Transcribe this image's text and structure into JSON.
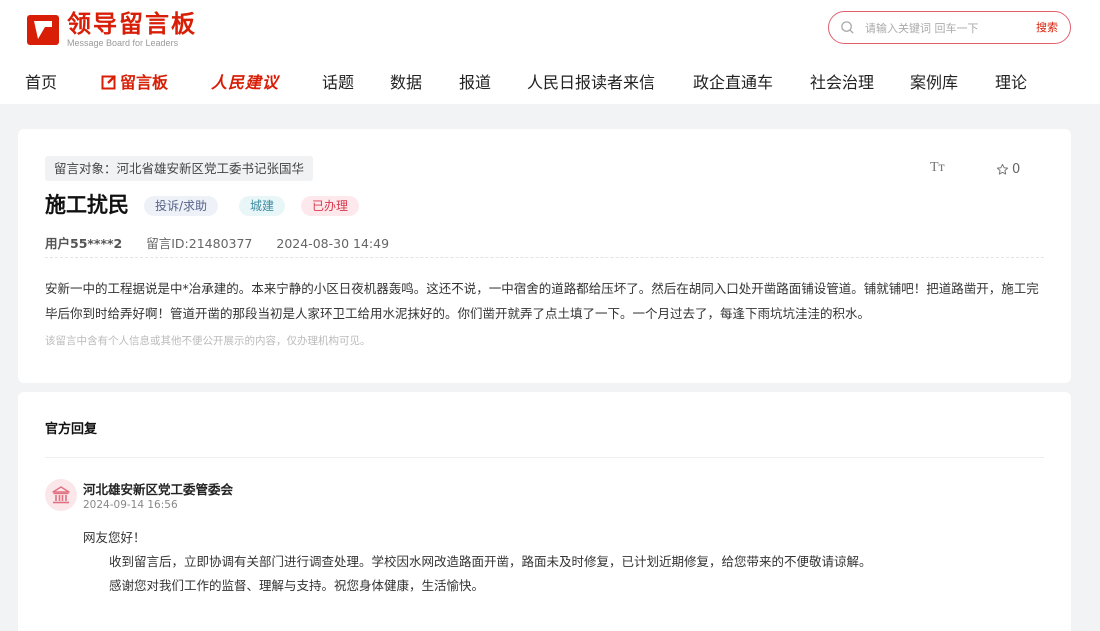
{
  "header": {
    "logo_title": "领导留言板",
    "logo_subtitle": "Message Board for Leaders",
    "search_placeholder": "请输入关键词 回车一下",
    "search_button": "搜索"
  },
  "nav": {
    "items": [
      {
        "label": "首页"
      },
      {
        "label": "留言板"
      },
      {
        "label": "人民建议"
      },
      {
        "label": "话题"
      },
      {
        "label": "数据"
      },
      {
        "label": "报道"
      },
      {
        "label": "人民日报读者来信"
      },
      {
        "label": "政企直通车"
      },
      {
        "label": "社会治理"
      },
      {
        "label": "案例库"
      },
      {
        "label": "理论"
      }
    ]
  },
  "message": {
    "target": "留言对象：河北省雄安新区党工委书记张国华",
    "font_toggle": "Tт",
    "fav_count": "0",
    "title": "施工扰民",
    "tags": {
      "type": "投诉/求助",
      "field": "城建",
      "status": "已办理"
    },
    "user": "用户55****2",
    "id": "留言ID:21480377",
    "datetime": "2024-08-30 14:49",
    "content": "安新一中的工程据说是中*冶承建的。本来宁静的小区日夜机器轰鸣。这还不说，一中宿舍的道路都给压坏了。然后在胡同入口处开凿路面铺设管道。铺就铺吧！把道路凿开，施工完毕后你到时给弄好啊！管道开凿的那段当初是人家环卫工给用水泥抹好的。你们凿开就弄了点土填了一下。一个月过去了，每逢下雨坑坑洼洼的积水。",
    "notice": "该留言中含有个人信息或其他不便公开展示的内容，仅办理机构可见。"
  },
  "reply": {
    "heading": "官方回复",
    "org_name": "河北雄安新区党工委管委会",
    "time": "2024-09-14 16:56",
    "greeting": "网友您好！",
    "line1": "收到留言后，立即协调有关部门进行调查处理。学校因水网改造路面开凿，路面未及时修复，已计划近期修复，给您带来的不便敬请谅解。",
    "line2": "感谢您对我们工作的监督、理解与支持。祝您身体健康，生活愉快。"
  },
  "colors": {
    "brand": "#d81e06",
    "page_bg": "#f2f3f5"
  }
}
